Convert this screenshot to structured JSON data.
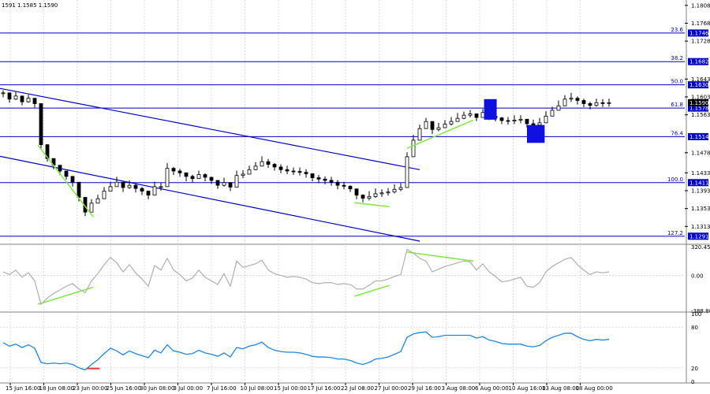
{
  "header": {
    "text": "1591 1.1585 1.1590"
  },
  "colors": {
    "candle": "#000000",
    "level": "#0000c8",
    "channel": "#0000c8",
    "divergence": "#7fe83c",
    "cci": "#b0b0b0",
    "rsi": "#1e88e5",
    "price_box": "#0000c8",
    "block": "#1010e0",
    "rsi_marker": "#e53935",
    "grid": "#c8c8c8"
  },
  "chart_data": [
    {
      "type": "line",
      "panel": "price",
      "ylim": [
        1.128,
        1.182
      ],
      "y_ticks": [
        "1.1808",
        "1.1768",
        "1.1728",
        "1.1643",
        "1.1603",
        "1.1563",
        "1.1478",
        "1.1433",
        "1.1393",
        "1.1353",
        "1.1313"
      ],
      "x_labels": [
        "15 Jun 16:00",
        "18 Jun 08:00",
        "23 Jun 00:00",
        "25 Jun 16:00",
        "30 Jun 08:00",
        "3 Jul 00:00",
        "7 Jul 16:00",
        "10 Jul 08:00",
        "15 Jul 00:00",
        "17 Jul 16:00",
        "22 Jul 08:00",
        "27 Jul 00:00",
        "29 Jul 16:00",
        "3 Aug 08:00",
        "6 Aug 00:00",
        "10 Aug 16:00",
        "13 Aug 08:00",
        "18 Aug 00:00"
      ],
      "levels": [
        {
          "label": "23.6",
          "value": 1.1746,
          "box": "1.1746"
        },
        {
          "label": "38.2",
          "value": 1.1682,
          "box": "1.1682"
        },
        {
          "label": "50.0",
          "value": 1.163,
          "box": "1.1630"
        },
        {
          "label": "61.8",
          "value": 1.1578,
          "box": "1.1578"
        },
        {
          "label": "76.4",
          "value": 1.1514,
          "box": "1.1514"
        },
        {
          "label": "100.0",
          "value": 1.1411,
          "box": "1.1411"
        },
        {
          "label": "127.2",
          "value": 1.1291,
          "box": "1.1291"
        }
      ],
      "current_price": "1.1590",
      "channel": {
        "upper": [
          [
            0,
            1.1622
          ],
          [
            66,
            1.144
          ]
        ],
        "lower": [
          [
            0,
            1.147
          ],
          [
            66,
            1.128
          ]
        ]
      },
      "divergence": [
        [
          [
            5.5,
            1.1495
          ],
          [
            14.3,
            1.1334
          ]
        ],
        [
          [
            55.7,
            1.1366
          ],
          [
            61.2,
            1.1357
          ]
        ],
        [
          [
            64,
            1.1488
          ],
          [
            74.5,
            1.1551
          ]
        ]
      ],
      "blocks": [
        {
          "from": 76.2,
          "to": 78.2,
          "low": 1.1552,
          "high": 1.1598
        },
        {
          "from": 83.0,
          "to": 85.8,
          "low": 1.15,
          "high": 1.154
        }
      ],
      "close": [
        1.1612,
        1.1598,
        1.1605,
        1.1592,
        1.16,
        1.1588,
        1.1496,
        1.1465,
        1.145,
        1.1437,
        1.1425,
        1.1412,
        1.1378,
        1.1345,
        1.1365,
        1.1375,
        1.1392,
        1.1402,
        1.1412,
        1.14,
        1.1405,
        1.1398,
        1.1392,
        1.1383,
        1.1402,
        1.1402,
        1.1443,
        1.1437,
        1.1433,
        1.1425,
        1.142,
        1.1429,
        1.1423,
        1.1416,
        1.1405,
        1.1411,
        1.1401,
        1.1427,
        1.143,
        1.144,
        1.1448,
        1.1458,
        1.1452,
        1.1446,
        1.144,
        1.1437,
        1.1436,
        1.1434,
        1.1431,
        1.1422,
        1.1419,
        1.1416,
        1.1412,
        1.1405,
        1.1403,
        1.1397,
        1.1383,
        1.1376,
        1.138,
        1.1386,
        1.1388,
        1.139,
        1.1396,
        1.14,
        1.1469,
        1.1506,
        1.1532,
        1.1548,
        1.153,
        1.1534,
        1.1542,
        1.1548,
        1.1555,
        1.1562,
        1.1565,
        1.1557,
        1.1568,
        1.156,
        1.1556,
        1.155,
        1.1549,
        1.1551,
        1.1553,
        1.1543,
        1.154,
        1.1545,
        1.156,
        1.1573,
        1.1583,
        1.1598,
        1.16,
        1.1595,
        1.1588,
        1.1584,
        1.159,
        1.1589,
        1.159
      ],
      "high": [
        1.1618,
        1.1608,
        1.1614,
        1.1602,
        1.1608,
        1.1596,
        1.1506,
        1.1476,
        1.1462,
        1.1449,
        1.1437,
        1.1424,
        1.139,
        1.1354,
        1.1374,
        1.1384,
        1.1401,
        1.1413,
        1.1424,
        1.1408,
        1.1416,
        1.1409,
        1.1401,
        1.1392,
        1.1413,
        1.1411,
        1.1455,
        1.1446,
        1.1442,
        1.1433,
        1.1429,
        1.1438,
        1.1432,
        1.1424,
        1.1416,
        1.1422,
        1.1412,
        1.1438,
        1.1439,
        1.1449,
        1.1457,
        1.147,
        1.1464,
        1.1455,
        1.1452,
        1.1449,
        1.1445,
        1.1445,
        1.1441,
        1.1431,
        1.1428,
        1.1425,
        1.1424,
        1.1417,
        1.1413,
        1.1405,
        1.1393,
        1.1385,
        1.1392,
        1.1398,
        1.1396,
        1.1399,
        1.1407,
        1.141,
        1.1479,
        1.1518,
        1.1541,
        1.1556,
        1.1539,
        1.1545,
        1.1551,
        1.1558,
        1.1567,
        1.157,
        1.1574,
        1.1566,
        1.1576,
        1.1571,
        1.1565,
        1.1558,
        1.1558,
        1.1562,
        1.1562,
        1.1552,
        1.1552,
        1.1556,
        1.1571,
        1.1581,
        1.1595,
        1.1607,
        1.1612,
        1.1604,
        1.1599,
        1.1592,
        1.1599,
        1.1598,
        1.1599
      ],
      "low": [
        1.1602,
        1.159,
        1.1596,
        1.1584,
        1.159,
        1.1579,
        1.1488,
        1.1458,
        1.1441,
        1.1428,
        1.1418,
        1.1402,
        1.1369,
        1.1336,
        1.1357,
        1.1366,
        1.1383,
        1.1394,
        1.1404,
        1.139,
        1.1397,
        1.1389,
        1.1383,
        1.1374,
        1.1393,
        1.1393,
        1.1434,
        1.1428,
        1.1424,
        1.1414,
        1.1412,
        1.142,
        1.1414,
        1.1408,
        1.1397,
        1.1402,
        1.1392,
        1.1418,
        1.1421,
        1.1432,
        1.1439,
        1.145,
        1.1444,
        1.1438,
        1.1432,
        1.143,
        1.1428,
        1.1427,
        1.1422,
        1.1414,
        1.141,
        1.1407,
        1.1404,
        1.1396,
        1.1396,
        1.139,
        1.1374,
        1.1367,
        1.1371,
        1.1377,
        1.1379,
        1.1382,
        1.1387,
        1.1392,
        1.1461,
        1.1497,
        1.1524,
        1.1539,
        1.152,
        1.1526,
        1.1533,
        1.1539,
        1.1548,
        1.1553,
        1.1557,
        1.1549,
        1.1559,
        1.1551,
        1.1548,
        1.1542,
        1.1541,
        1.1542,
        1.1544,
        1.1534,
        1.1532,
        1.1537,
        1.1552,
        1.1565,
        1.1575,
        1.159,
        1.1592,
        1.1586,
        1.158,
        1.1575,
        1.1581,
        1.158,
        1.1581
      ]
    },
    {
      "type": "line",
      "panel": "cci",
      "ylim": [
        -388.803,
        320.4558
      ],
      "y_ticks": [
        "320.4558",
        "0.00",
        "-388.803"
      ],
      "divergence": [
        [
          [
            5.5,
            -320
          ],
          [
            14.3,
            -130
          ]
        ],
        [
          [
            55.7,
            -230
          ],
          [
            61.2,
            -110
          ]
        ],
        [
          [
            64,
            260
          ],
          [
            74.5,
            160
          ]
        ]
      ],
      "values": [
        40,
        10,
        60,
        -20,
        30,
        -60,
        -320,
        -250,
        -200,
        -160,
        -120,
        -90,
        -150,
        -190,
        -60,
        20,
        120,
        200,
        140,
        40,
        120,
        30,
        -40,
        -120,
        110,
        60,
        190,
        60,
        10,
        -60,
        -30,
        60,
        -20,
        -60,
        -100,
        20,
        -120,
        160,
        90,
        110,
        130,
        170,
        60,
        20,
        0,
        -20,
        -10,
        -20,
        -40,
        -80,
        -90,
        -80,
        -80,
        -100,
        -90,
        -100,
        -150,
        -150,
        -110,
        -60,
        -60,
        -40,
        -10,
        10,
        290,
        250,
        190,
        160,
        40,
        70,
        100,
        120,
        140,
        160,
        150,
        60,
        130,
        40,
        -10,
        -70,
        -60,
        -40,
        -20,
        -120,
        -130,
        -80,
        40,
        100,
        140,
        180,
        200,
        120,
        60,
        10,
        40,
        30,
        40
      ]
    },
    {
      "type": "line",
      "panel": "rsi",
      "ylim": [
        0,
        100
      ],
      "y_ticks": [
        "100",
        "80",
        "20",
        "0"
      ],
      "marker": [
        [
          14.3,
          19
        ]
      ],
      "values": [
        57,
        52,
        55,
        50,
        54,
        49,
        28,
        26,
        27,
        26,
        27,
        25,
        20,
        17,
        25,
        32,
        41,
        49,
        45,
        39,
        45,
        41,
        38,
        35,
        46,
        42,
        54,
        45,
        43,
        40,
        41,
        46,
        42,
        40,
        37,
        42,
        36,
        50,
        48,
        52,
        54,
        58,
        50,
        46,
        44,
        43,
        43,
        42,
        40,
        37,
        36,
        36,
        35,
        33,
        33,
        31,
        27,
        25,
        28,
        33,
        34,
        36,
        40,
        44,
        65,
        70,
        72,
        73,
        65,
        66,
        68,
        68,
        68,
        68,
        68,
        64,
        66,
        61,
        59,
        56,
        55,
        55,
        55,
        52,
        51,
        53,
        60,
        65,
        68,
        71,
        71,
        66,
        62,
        60,
        62,
        61,
        62
      ]
    }
  ]
}
